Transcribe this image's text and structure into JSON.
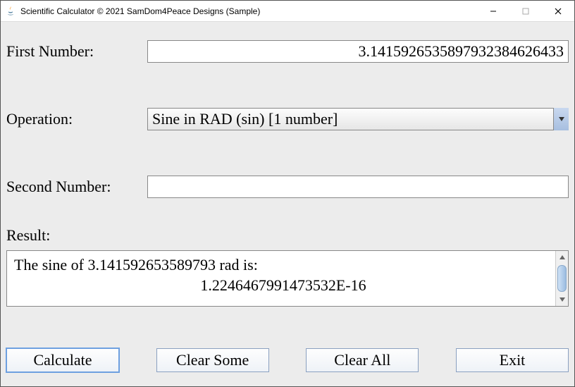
{
  "window": {
    "title": "Scientific Calculator © 2021 SamDom4Peace Designs (Sample)"
  },
  "labels": {
    "first_number": "First Number:",
    "operation": "Operation:",
    "second_number": "Second Number:",
    "result": "Result:"
  },
  "inputs": {
    "first_number": "3.1415926535897932384626433",
    "second_number": ""
  },
  "operation": {
    "selected": "Sine in RAD (sin) [1 number]"
  },
  "result": {
    "line1": "The sine of 3.141592653589793 rad is:",
    "line2": "1.2246467991473532E-16"
  },
  "buttons": {
    "calculate": "Calculate",
    "clear_some": "Clear Some",
    "clear_all": "Clear All",
    "exit": "Exit"
  }
}
